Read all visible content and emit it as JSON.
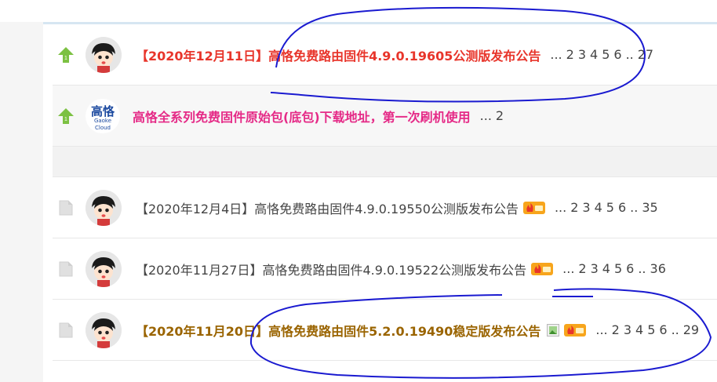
{
  "threads": [
    {
      "type": "pinned",
      "style": "red",
      "title": "【2020年12月11日】高恪免费路由固件4.9.0.19605公测版发布公告",
      "pages": [
        "...",
        "2",
        "3",
        "4",
        "5",
        "6",
        "..",
        "27"
      ]
    },
    {
      "type": "pinned",
      "style": "pink",
      "title": "高恪全系列免费固件原始包(底包)下载地址，第一次刷机使用",
      "pages": [
        "...",
        "2"
      ],
      "logo": {
        "line1": "高恪",
        "line2": "Gaoke Cloud"
      }
    },
    {
      "type": "normal",
      "style": "normal",
      "title": "【2020年12月4日】高恪免费路由固件4.9.0.19550公测版发布公告",
      "hot": true,
      "pages": [
        "...",
        "2",
        "3",
        "4",
        "5",
        "6",
        "..",
        "35"
      ]
    },
    {
      "type": "normal",
      "style": "normal",
      "title": "【2020年11月27日】高恪免费路由固件4.9.0.19522公测版发布公告",
      "hot": true,
      "pages": [
        "...",
        "2",
        "3",
        "4",
        "5",
        "6",
        "..",
        "36"
      ]
    },
    {
      "type": "normal",
      "style": "gold",
      "title": "【2020年11月20日】高恪免费路由固件5.2.0.19490稳定版发布公告",
      "image": true,
      "hot": true,
      "pages": [
        "...",
        "2",
        "3",
        "4",
        "5",
        "6",
        "..",
        "29"
      ]
    }
  ],
  "colors": {
    "red_title": "#e8352b",
    "pink_title": "#e52a87",
    "gold_title": "#9a6400",
    "pin_arrow": "#7cc142",
    "annotation": "#1a1ad0"
  }
}
